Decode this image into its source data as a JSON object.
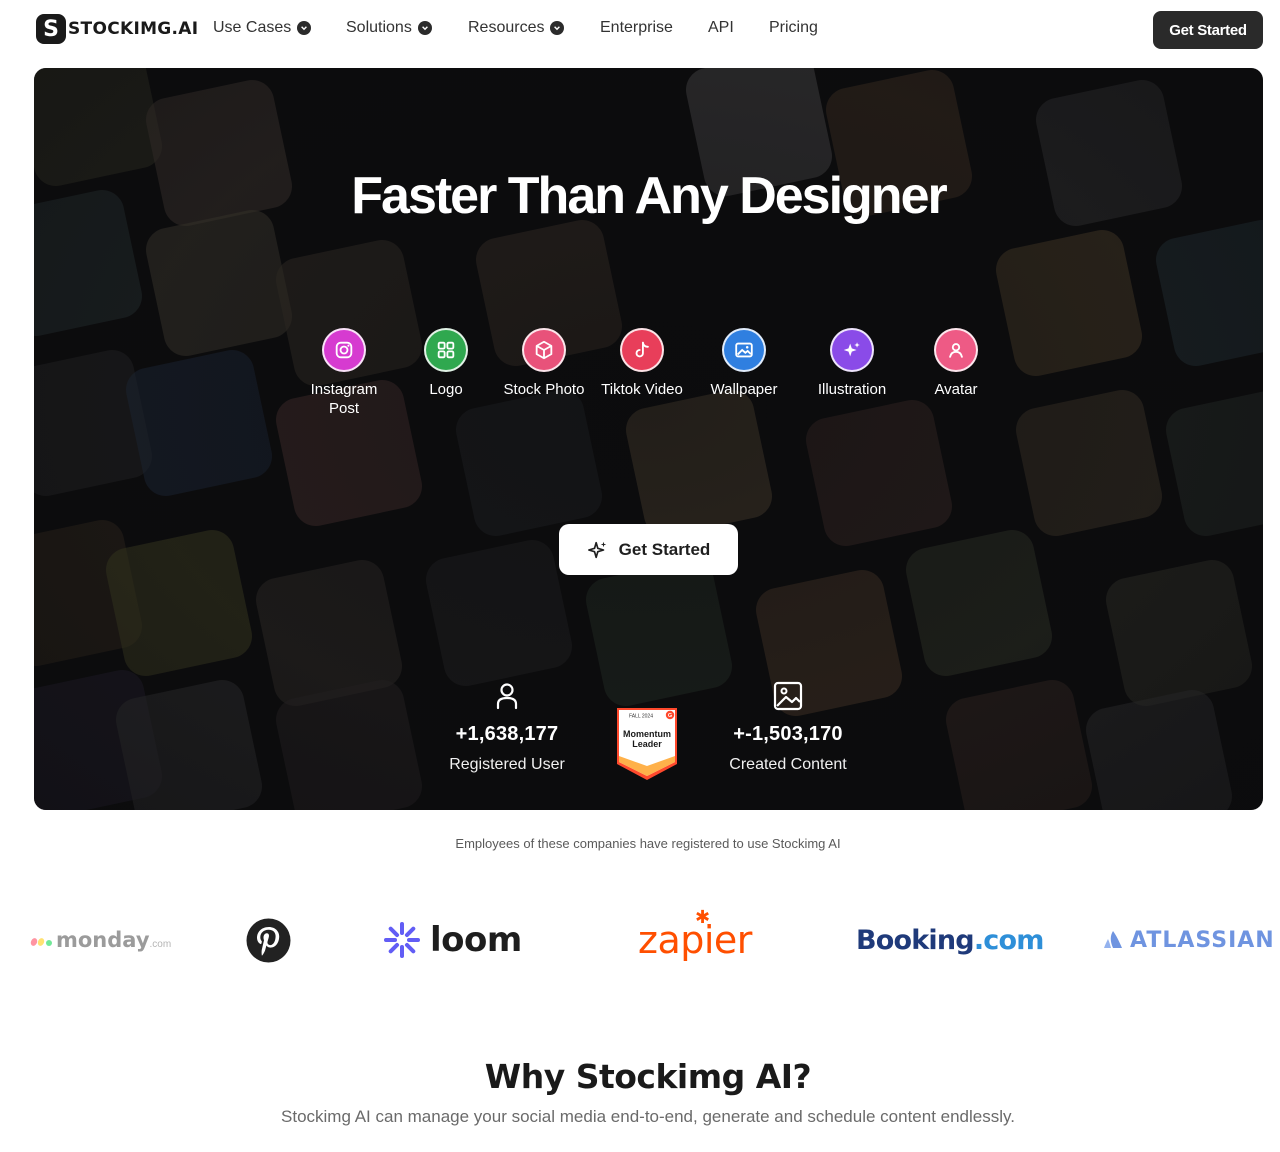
{
  "nav": {
    "logo_letter": "S",
    "logo_text": "STOCKIMG.AI",
    "items": [
      {
        "label": "Use Cases",
        "dropdown": true
      },
      {
        "label": "Solutions",
        "dropdown": true
      },
      {
        "label": "Resources",
        "dropdown": true
      },
      {
        "label": "Enterprise",
        "dropdown": false
      },
      {
        "label": "API",
        "dropdown": false
      },
      {
        "label": "Pricing",
        "dropdown": false
      }
    ],
    "cta": "Get Started"
  },
  "hero": {
    "title": "Faster Than Any Designer",
    "categories": [
      {
        "label": "Instagram Post",
        "icon": "instagram-icon",
        "color": "#d63bd0"
      },
      {
        "label": "Logo",
        "icon": "grid-icon",
        "color": "#2fa84f"
      },
      {
        "label": "Stock Photo",
        "icon": "cube-icon",
        "color": "#e8527a"
      },
      {
        "label": "Tiktok Video",
        "icon": "tiktok-icon",
        "color": "#e83e5a"
      },
      {
        "label": "Wallpaper",
        "icon": "image-icon",
        "color": "#2f7fe0"
      },
      {
        "label": "Illustration",
        "icon": "sparkle-icon",
        "color": "#8a4be8"
      },
      {
        "label": "Avatar",
        "icon": "person-icon",
        "color": "#ee5a85"
      }
    ],
    "cta": "Get Started",
    "stats": [
      {
        "value": "+1,638,177",
        "label": "Registered User",
        "icon": "user-icon"
      },
      {
        "value": "+-1,503,170",
        "label": "Created Content",
        "icon": "image-icon"
      }
    ],
    "badge": {
      "season": "FALL 2024",
      "line1": "Momentum",
      "line2": "Leader",
      "accent": "#ff492c"
    }
  },
  "companies": {
    "caption": "Employees of these companies have registered to use Stockimg AI",
    "brands": [
      {
        "name": "monday",
        "suffix": ".com"
      },
      {
        "name": "pinterest-logo"
      },
      {
        "name": "loom"
      },
      {
        "name": "zapier"
      },
      {
        "name": "Booking",
        "suffix": ".com"
      },
      {
        "name": "ATLASSIAN"
      }
    ]
  },
  "why": {
    "title": "Why Stockimg AI?",
    "subtitle": "Stockimg AI can manage your social media end-to-end, generate and schedule content endlessly."
  }
}
